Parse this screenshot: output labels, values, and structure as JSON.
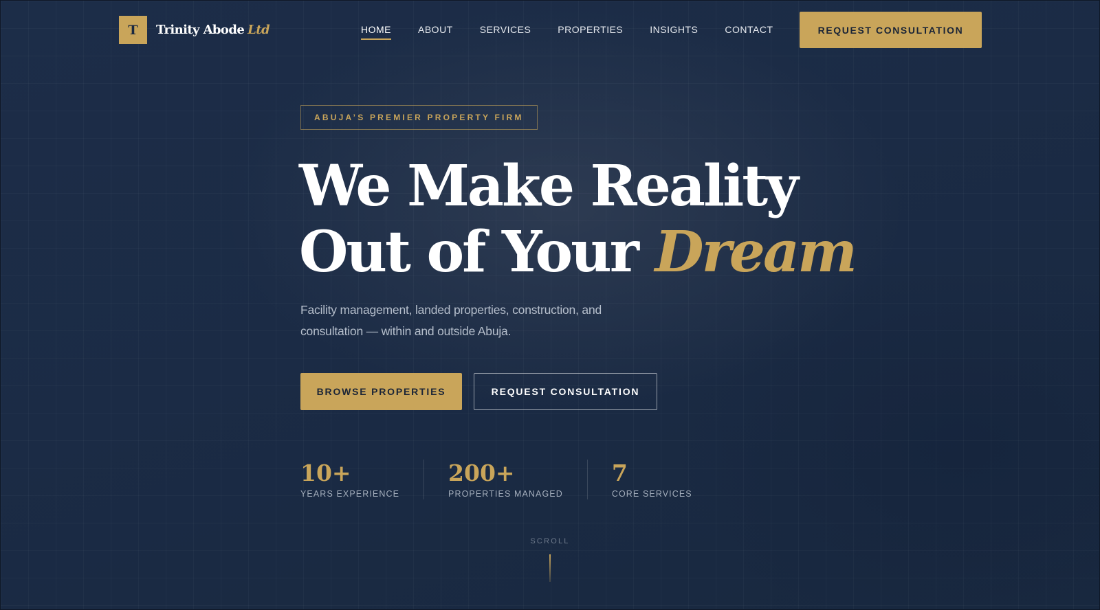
{
  "header": {
    "logo_mark": "T",
    "logo_name": "Trinity Abode",
    "logo_suffix": "Ltd",
    "nav": [
      {
        "label": "HOME",
        "active": true
      },
      {
        "label": "ABOUT"
      },
      {
        "label": "SERVICES"
      },
      {
        "label": "PROPERTIES"
      },
      {
        "label": "INSIGHTS"
      },
      {
        "label": "CONTACT"
      }
    ],
    "cta_label": "REQUEST CONSULTATION"
  },
  "hero": {
    "eyebrow": "ABUJA’S PREMIER PROPERTY FIRM",
    "headline_line1": "We Make Reality",
    "headline_line2_prefix": "Out of Your",
    "headline_line2_accent": "Dream",
    "subtitle": "Facility management, landed properties, construction, and consultation — within and outside Abuja.",
    "primary_button": "BROWSE PROPERTIES",
    "secondary_button": "REQUEST CONSULTATION"
  },
  "stats": [
    {
      "value": "10+",
      "label": "YEARS EXPERIENCE"
    },
    {
      "value": "200+",
      "label": "PROPERTIES MANAGED"
    },
    {
      "value": "7",
      "label": "CORE SERVICES"
    }
  ],
  "scroll_label": "SCROLL",
  "colors": {
    "accent_gold": "#c9a55a",
    "background_navy": "#1b2b45"
  }
}
